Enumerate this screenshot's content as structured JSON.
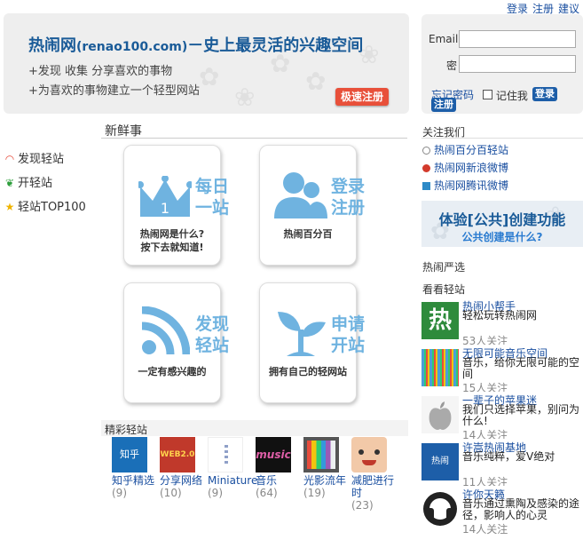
{
  "toplinks": {
    "login": "登录",
    "register": "注册",
    "suggest": "建议"
  },
  "banner": {
    "title_brand": "热闹网",
    "title_domain": "(renao100.com)",
    "title_slogan": "－史上最灵活的兴趣空间",
    "line1": "+发现  收集  分享喜欢的事物",
    "line2": "+为喜欢的事物建立一个轻型网站",
    "quick_register": "极速注册"
  },
  "login": {
    "email_label": "Email",
    "password_label": "密",
    "forgot": "忘记密码",
    "remember": "记住我",
    "login_btn": "登录",
    "register_btn": "注册"
  },
  "leftnav": [
    {
      "label": "发现轻站",
      "icon": "rss-icon"
    },
    {
      "label": "开轻站",
      "icon": "sprout-icon"
    },
    {
      "label": "轻站TOP100",
      "icon": "star-icon"
    }
  ],
  "fresh": {
    "title": "新鲜事"
  },
  "tiles": [
    {
      "head1": "每日",
      "head2": "一站",
      "sub1": "热闹网是什么?",
      "sub2": "按下去就知道!",
      "icon": "crown-icon"
    },
    {
      "head1": "登录",
      "head2": "注册",
      "sub1": "热闹百分百",
      "sub2": "",
      "icon": "users-icon"
    },
    {
      "head1": "发现",
      "head2": "轻站",
      "sub1": "一定有感兴趣的",
      "sub2": "",
      "icon": "rss-icon"
    },
    {
      "head1": "申请",
      "head2": "开站",
      "sub1": "拥有自己的轻网站",
      "sub2": "",
      "icon": "sprout-icon"
    }
  ],
  "featured": {
    "title": "精彩轻站",
    "items": [
      {
        "name": "知乎精选",
        "count": "(9)",
        "color": "#1a6fb8",
        "thumb_text": "知乎"
      },
      {
        "name": "分享网络",
        "count": "(10)",
        "color": "#c0392b",
        "thumb_text": "WEB2.0"
      },
      {
        "name": "Miniature",
        "count": "(9)",
        "color": "#ffffff",
        "thumb_text": ""
      },
      {
        "name": "音乐",
        "count": "(64)",
        "color": "#111111",
        "thumb_text": "music"
      },
      {
        "name": "光影流年",
        "count": "(19)",
        "color": "#555555",
        "thumb_text": ""
      },
      {
        "name": "减肥进行时",
        "count": "(23)",
        "color": "#f2c9a8",
        "thumb_text": ""
      }
    ]
  },
  "follow": {
    "title": "关注我们",
    "items": [
      {
        "label": "热闹百分百轻站",
        "color": "#888888"
      },
      {
        "label": "热闹网新浪微博",
        "color": "#d33a2c"
      },
      {
        "label": "热闹网腾讯微博",
        "color": "#2d8ac7"
      }
    ]
  },
  "promo": {
    "line1": "体验[公共]创建功能",
    "line2": "公共创建是什么?"
  },
  "yanxuan": {
    "title": "热闹严选"
  },
  "look": {
    "title": "看看轻站",
    "sites": [
      {
        "name": "热闹小帮手",
        "desc": "轻松玩转热闹网",
        "followers": "53人关注",
        "thumb": "热",
        "color": "#2e8b3c"
      },
      {
        "name": "无限可能音乐空间",
        "desc": "音乐，给你无限可能的空间",
        "followers": "15人关注",
        "thumb": "",
        "color": "#4a9fd8"
      },
      {
        "name": "一辈子的苹果迷",
        "desc": "我们只选择苹果，别问为什么!",
        "followers": "14人关注",
        "thumb": "",
        "color": "#cfcfcf"
      },
      {
        "name": "许嵩热闹基地",
        "desc": "音乐纯粹，爱V绝对",
        "followers": "11人关注",
        "thumb": "热闹",
        "color": "#1d5ea8"
      },
      {
        "name": "许你天籁",
        "desc": "音乐通过熏陶及感染的途径，影响人的心灵",
        "followers": "14人关注",
        "thumb": "",
        "color": "#222222"
      }
    ]
  }
}
